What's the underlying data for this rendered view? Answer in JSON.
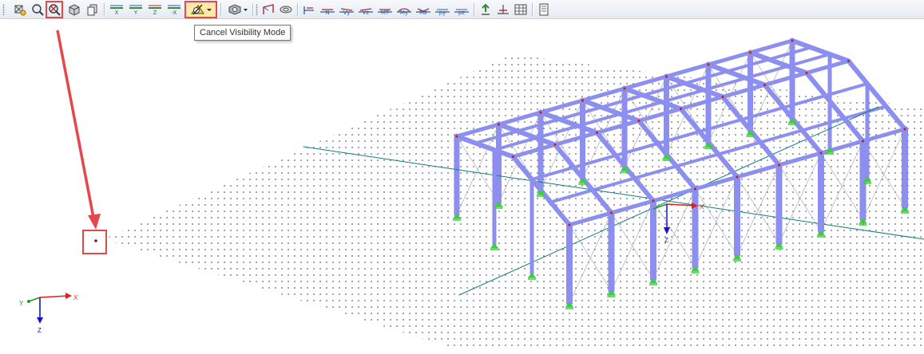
{
  "toolbar": {
    "buttons": [
      {
        "name": "display-properties-icon",
        "label": ""
      },
      {
        "name": "view-zoom-icon",
        "label": ""
      },
      {
        "name": "visibility-mode-icon",
        "label": ""
      },
      {
        "name": "view-3d-icon",
        "label": ""
      },
      {
        "name": "copy-view-icon",
        "label": ""
      },
      {
        "name": "view-x-icon",
        "label": "X"
      },
      {
        "name": "view-y-icon",
        "label": "Y"
      },
      {
        "name": "view-z-icon",
        "label": "Z"
      },
      {
        "name": "view-minus-x-icon",
        "label": "-X"
      },
      {
        "name": "cancel-visibility-mode-icon",
        "label": ""
      },
      {
        "name": "render-options-icon",
        "label": ""
      },
      {
        "name": "member-line-icon",
        "label": ""
      },
      {
        "name": "section-icon",
        "label": ""
      },
      {
        "name": "result-u-icon",
        "label": ""
      },
      {
        "name": "result-n-icon",
        "label": "N"
      },
      {
        "name": "result-vy-icon",
        "label": "Vy"
      },
      {
        "name": "result-vz-icon",
        "label": "Vz"
      },
      {
        "name": "result-mt-icon",
        "label": "MT"
      },
      {
        "name": "result-my-icon",
        "label": "My"
      },
      {
        "name": "result-mz-icon",
        "label": "Mz"
      },
      {
        "name": "result-py-icon",
        "label": "py"
      },
      {
        "name": "result-pz-icon",
        "label": "pz"
      },
      {
        "name": "support-reactions-icon",
        "label": ""
      },
      {
        "name": "stress-icon",
        "label": ""
      },
      {
        "name": "grid-table-icon",
        "label": ""
      },
      {
        "name": "report-icon",
        "label": ""
      }
    ]
  },
  "tooltip": {
    "text": "Cancel Visibility Mode"
  },
  "axes": {
    "x": "X",
    "y": "Y",
    "z": "Z"
  },
  "colors": {
    "member": "#8c8ff0",
    "member_dark": "#6b6ed6",
    "highlight": "#e5474b",
    "support": "#3ccf3c",
    "grid_line": "#0f7c7c",
    "node": "#c0262c",
    "tooltip_border": "#767676"
  }
}
